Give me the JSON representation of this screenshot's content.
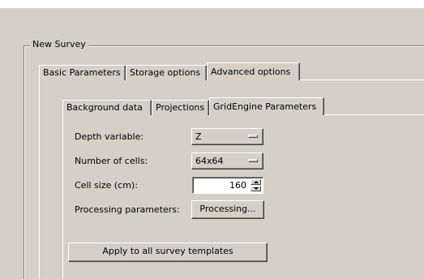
{
  "group": {
    "title": "New Survey"
  },
  "outer_tabs": [
    {
      "label": "Basic Parameters",
      "active": false
    },
    {
      "label": "Storage options",
      "active": false
    },
    {
      "label": "Advanced options",
      "active": true
    }
  ],
  "inner_tabs": [
    {
      "label": "Background data",
      "active": false
    },
    {
      "label": "Projections",
      "active": false
    },
    {
      "label": "GridEngine Parameters",
      "active": true
    }
  ],
  "form": {
    "depth_variable": {
      "label": "Depth variable:",
      "value": "Z"
    },
    "number_of_cells": {
      "label": "Number of cells:",
      "value": "64x64"
    },
    "cell_size": {
      "label": "Cell size (cm):",
      "value": "160"
    },
    "processing_parameters": {
      "label": "Processing parameters:",
      "button_label": "Processing..."
    }
  },
  "apply_button": {
    "label": "Apply to all survey templates"
  }
}
